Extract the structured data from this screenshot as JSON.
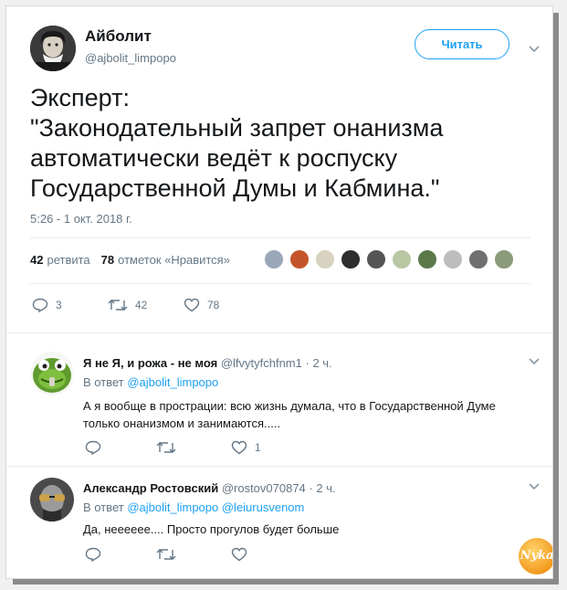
{
  "tweet": {
    "author_name": "Айболит",
    "author_handle": "@ajbolit_limpopo",
    "follow_label": "Читать",
    "text_lines": [
      "Эксперт:",
      "\"Законодательный запрет онанизма",
      "автоматически ведёт к роспуску",
      "Государственной Думы и Кабмина.\""
    ],
    "timestamp": "5:26 - 1 окт. 2018 г.",
    "retweets_count": "42",
    "retweets_label": "ретвита",
    "likes_count": "78",
    "likes_label": "отметок «Нравится»",
    "actions": {
      "reply": "3",
      "retweet": "42",
      "like": "78"
    }
  },
  "replies": [
    {
      "name": "Я не Я, и рожа - не моя",
      "handle": "@lfvytyfchfnm1",
      "time": "2 ч.",
      "reply_prefix": "В ответ",
      "reply_to": "@ajbolit_limpopo",
      "text_lines": [
        "А я вообще в прострации: всю жизнь думала, что в Государственной Думе",
        "только онанизмом и занимаются....."
      ],
      "actions": {
        "reply": "",
        "retweet": "",
        "like": "1"
      }
    },
    {
      "name": "Александр Ростовский",
      "handle": "@rostov070874",
      "time": "2 ч.",
      "reply_prefix": "В ответ",
      "reply_to": "@ajbolit_limpopo @leiurusvenom",
      "text_lines": [
        "Да, нееееее.... Просто прогулов будет больше"
      ],
      "actions": {
        "reply": "",
        "retweet": "",
        "like": ""
      }
    }
  ],
  "watermark": "Nyka",
  "colors": {
    "accent": "#1da1f2",
    "muted": "#657786",
    "text": "#14171a",
    "divider": "#e6ecf0"
  },
  "icons": [
    "caret-down-icon",
    "reply-icon",
    "retweet-icon",
    "heart-icon"
  ]
}
